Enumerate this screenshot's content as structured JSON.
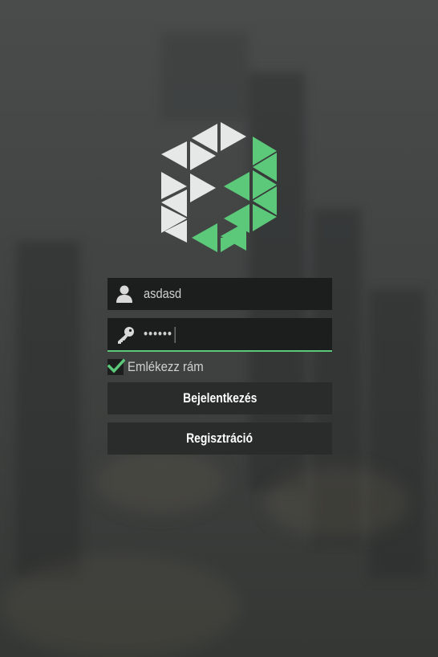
{
  "login": {
    "username_value": "asdasd",
    "password_value": "••••••",
    "remember_label": "Emlékezz rám",
    "remember_checked": true,
    "login_button": "Bejelentkezés",
    "register_button": "Regisztráció"
  },
  "icons": {
    "logo": "hexagon-logo",
    "username": "user-icon",
    "password": "key-icon",
    "checkbox": "checkmark-icon"
  },
  "colors": {
    "accent": "#5cc97a",
    "field_bg": "#1c1d1d",
    "button_bg": "#2a2b2b",
    "logo_light": "#e6e7e7",
    "logo_green": "#5cc97a"
  }
}
